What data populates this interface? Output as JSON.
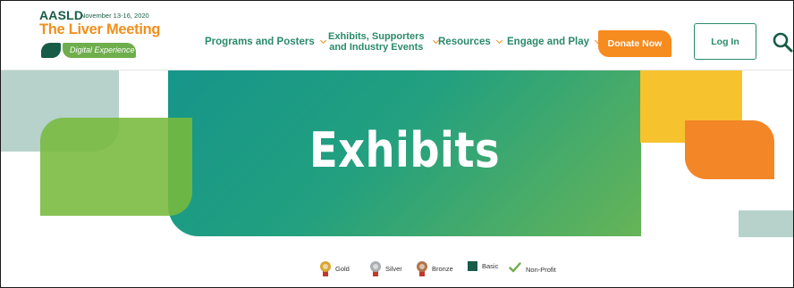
{
  "header": {
    "logo": {
      "org": "AASLD",
      "date": "November 13-16, 2020",
      "title": "The Liver Meeting",
      "subtitle": "Digital Experience"
    },
    "nav": [
      {
        "label": "Programs and Posters"
      },
      {
        "label_line1": "Exhibits, Supporters",
        "label_line2": "and Industry Events"
      },
      {
        "label": "Resources"
      },
      {
        "label": "Engage and Play"
      }
    ],
    "donate_label": "Donate Now",
    "login_label": "Log In",
    "search_icon": "search-icon"
  },
  "hero": {
    "title": "Exhibits"
  },
  "legend": {
    "items": [
      {
        "label": "Gold",
        "icon": "gold-medal-icon",
        "color": "#d8a635"
      },
      {
        "label": "Silver",
        "icon": "silver-medal-icon",
        "color": "#a9aeb1"
      },
      {
        "label": "Bronze",
        "icon": "bronze-medal-icon",
        "color": "#b07449"
      },
      {
        "label": "Basic",
        "icon": "basic-square-icon",
        "color": "#175c46"
      },
      {
        "label": "Non-Profit",
        "icon": "check-icon",
        "color": "#6fae4c"
      }
    ]
  },
  "colors": {
    "brand_green": "#2a8a6b",
    "brand_dark": "#175c46",
    "accent_orange": "#f68b1f",
    "accent_yellow": "#f6c22d"
  }
}
